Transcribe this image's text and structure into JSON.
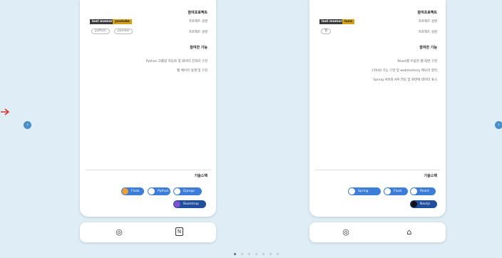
{
  "nav": {
    "prev_icon": "chevron-left-icon",
    "next_icon": "chevron-right-icon"
  },
  "cards": [
    {
      "section1_title": "참여프로젝트",
      "info_lines": [
        "프로젝트 설명",
        "프로젝트 설명"
      ],
      "tags": [
        "lost memory",
        "youtube"
      ],
      "pills": [
        "python",
        "pandas"
      ],
      "section2_title": "참여한 기능",
      "features": [
        "Python 크롤링 자동화 및 데이터 전처리 구현",
        "웹 페이지 설계 및 구현"
      ],
      "section3_title": "기술스택",
      "badges": [
        "Django",
        "Python",
        "Flask",
        "Bootstrap"
      ],
      "footer_icons": [
        "github-icon",
        "notion-icon"
      ]
    },
    {
      "section1_title": "참여프로젝트",
      "info_lines": [
        "프로젝트 설명",
        "프로젝트 설명"
      ],
      "tags": [
        "lost memory",
        "luna"
      ],
      "pills": [
        "웹"
      ],
      "section2_title": "참여한 기능",
      "features": [
        "React를 이용한 웹 화면 구현",
        "CRUD 기능 구현 및 webmemory 메모리 정리",
        "Spring 서버와 API 연동 및 화면에 데이터 표시"
      ],
      "section3_title": "기술스택",
      "badges": [
        "React",
        "Flask",
        "Spring",
        "Nextjs"
      ],
      "footer_icons": [
        "github-icon",
        "home-icon"
      ]
    }
  ],
  "colors": {
    "tag_gold": "#d4a017",
    "tag_dark": "#3a3a3a",
    "badge_blue": "#3b7dd8",
    "badge_dark": "#1f4e9c",
    "nav_blue": "#4a8fc9",
    "arrow_red": "#e0332b"
  }
}
